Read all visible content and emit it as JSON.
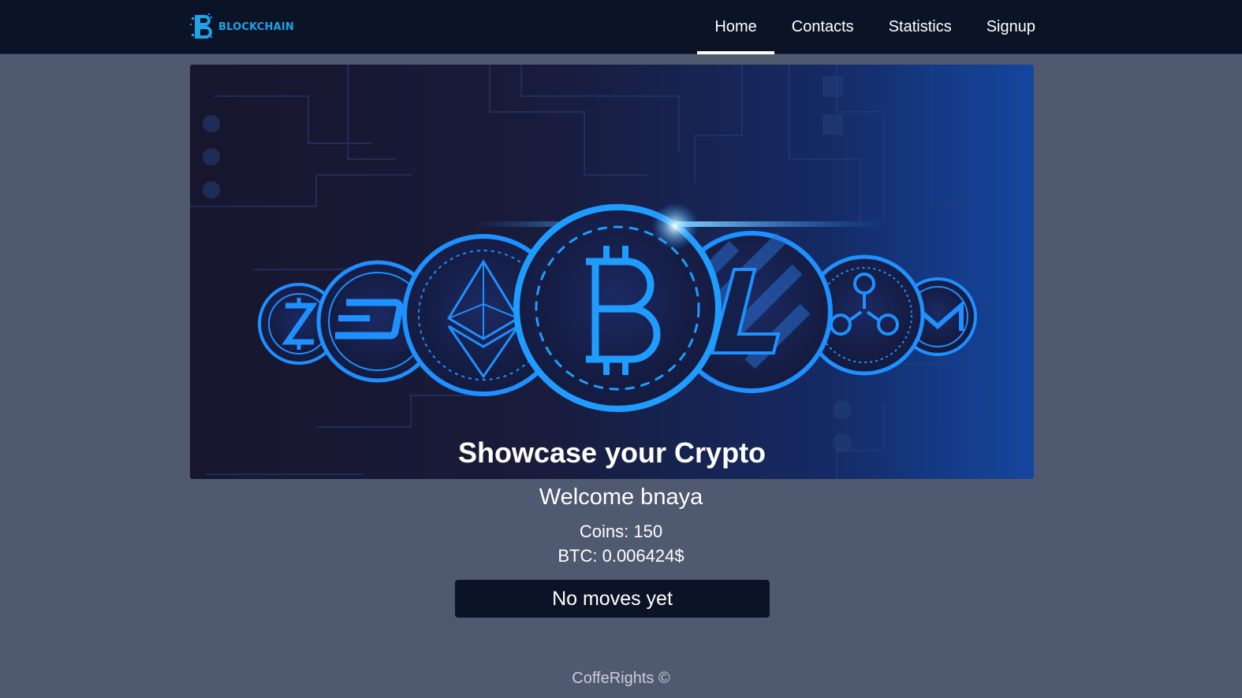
{
  "header": {
    "logo_text": "BLOCKCHAIN",
    "nav": [
      {
        "label": "Home",
        "active": true
      },
      {
        "label": "Contacts",
        "active": false
      },
      {
        "label": "Statistics",
        "active": false
      },
      {
        "label": "Signup",
        "active": false
      }
    ]
  },
  "hero": {
    "title": "Showcase your Crypto",
    "coins": [
      "zcash-coin-icon",
      "dash-coin-icon",
      "ethereum-coin-icon",
      "bitcoin-coin-icon",
      "litecoin-coin-icon",
      "ripple-coin-icon",
      "monero-coin-icon"
    ]
  },
  "user": {
    "welcome": "Welcome bnaya",
    "coins": "Coins: 150",
    "btc": "BTC: 0.006424$"
  },
  "moves": {
    "empty_text": "No moves yet"
  },
  "footer": {
    "text": "CoffeRights ©"
  },
  "colors": {
    "page_bg": "#4f5970",
    "navbar_bg": "#0b1326",
    "accent": "#1fa3e6",
    "coin_glow": "#1e90ff"
  }
}
